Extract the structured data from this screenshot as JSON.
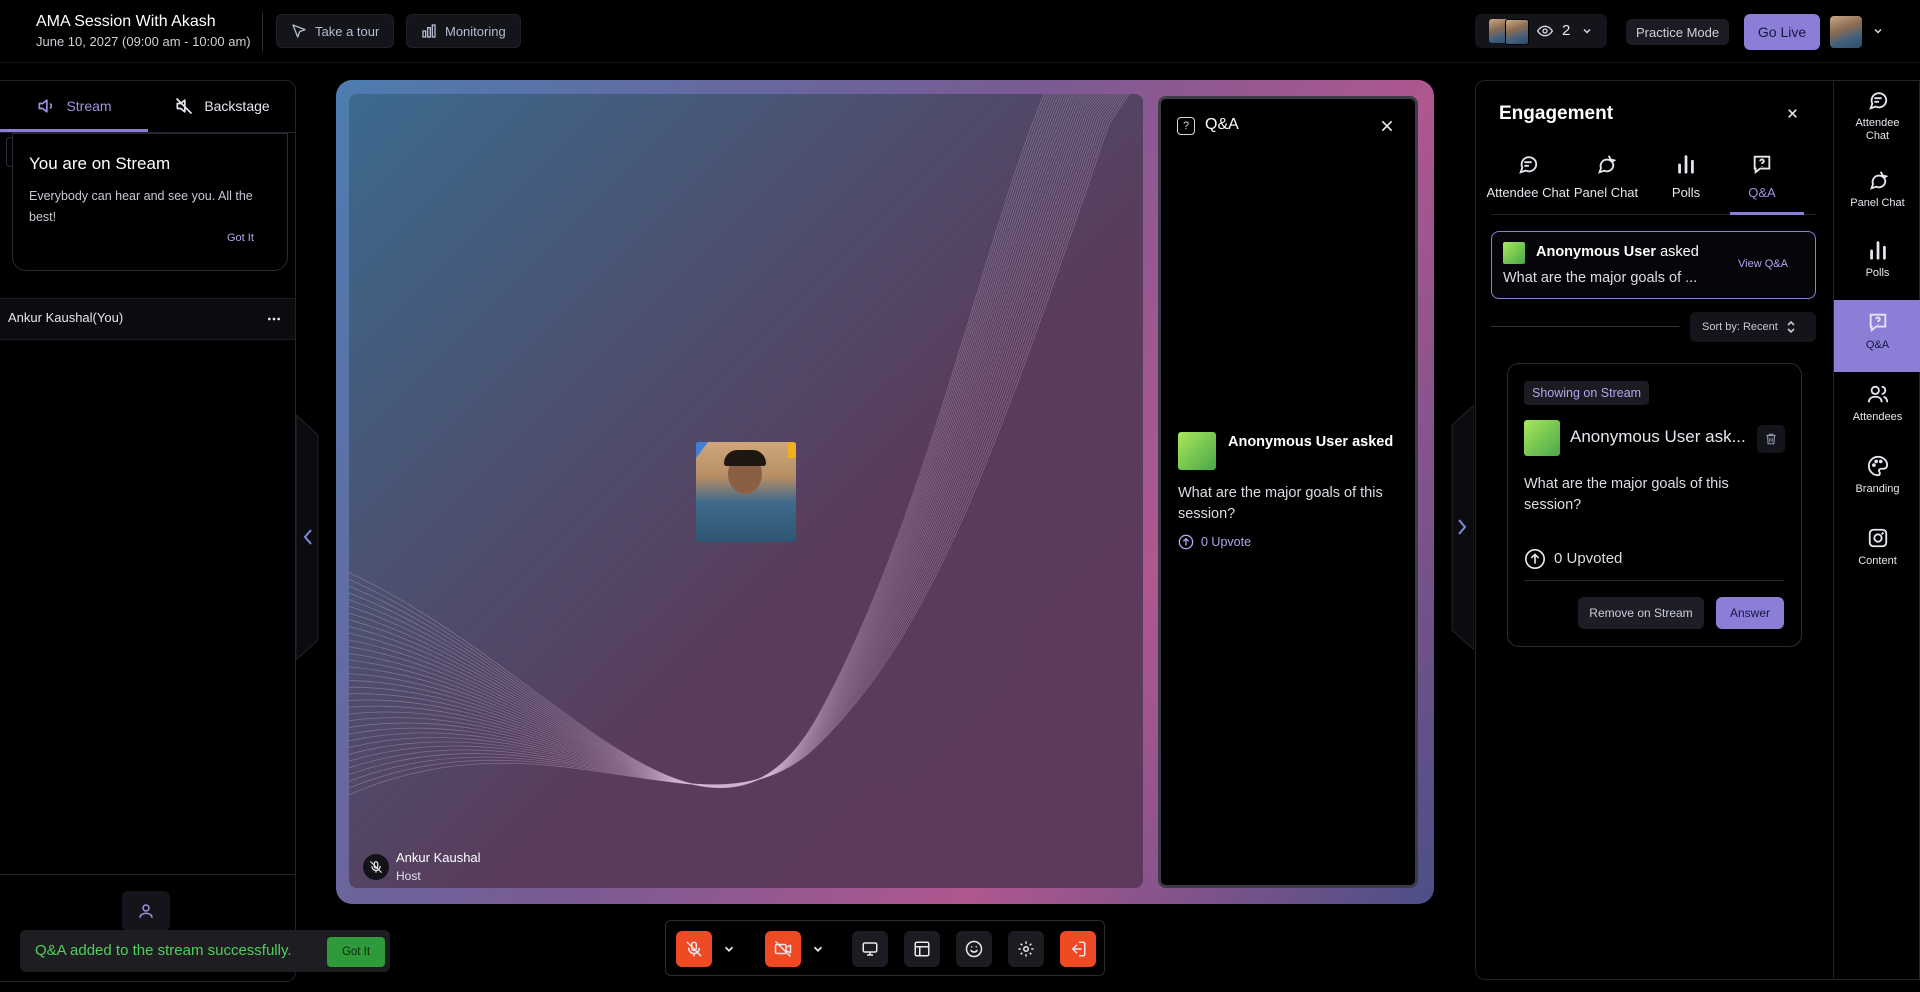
{
  "header": {
    "title": "AMA Session With Akash",
    "subtitle": "June 10, 2027 (09:00 am - 10:00 am)",
    "take_tour_label": "Take a tour",
    "monitoring_label": "Monitoring",
    "viewer_count": "2",
    "practice_mode_label": "Practice Mode",
    "go_live_label": "Go Live"
  },
  "left_panel": {
    "tabs": [
      {
        "label": "Stream",
        "active": true
      },
      {
        "label": "Backstage",
        "active": false
      }
    ],
    "notice": {
      "title": "You are on Stream",
      "body": "Everybody can hear and see you. All the best!",
      "button": "Got It"
    },
    "participant": {
      "name": "Ankur Kaushal(You)"
    }
  },
  "stage": {
    "speaker_name": "Ankur Kaushal",
    "speaker_role": "Host",
    "qa_overlay": {
      "title": "Q&A",
      "asker": "Anonymous User asked",
      "question": "What are the major goals of this session?",
      "upvote": "0 Upvote"
    }
  },
  "engagement": {
    "title": "Engagement",
    "tabs": [
      {
        "label": "Attendee Chat",
        "icon": "chat-icon"
      },
      {
        "label": "Panel Chat",
        "icon": "panel-chat-icon"
      },
      {
        "label": "Polls",
        "icon": "polls-icon"
      },
      {
        "label": "Q&A",
        "icon": "qa-icon",
        "active": true
      }
    ],
    "featured": {
      "user": "Anonymous User",
      "asked": "asked",
      "question": "What are the major goals of ...",
      "link": "View Q&A"
    },
    "sort_label": "Sort by: Recent",
    "question_card": {
      "badge": "Showing on Stream",
      "asker": "Anonymous User ask...",
      "question": "What are the major goals of this session?",
      "upvotes": "0 Upvoted",
      "remove_label": "Remove on Stream",
      "answer_label": "Answer"
    }
  },
  "right_rail": [
    {
      "label": "Attendee Chat",
      "icon": "chat-icon"
    },
    {
      "label": "Panel Chat",
      "icon": "panel-chat-icon"
    },
    {
      "label": "Polls",
      "icon": "polls-icon"
    },
    {
      "label": "Q&A",
      "icon": "qa-icon",
      "active": true
    },
    {
      "label": "Attendees",
      "icon": "attendees-icon"
    },
    {
      "label": "Branding",
      "icon": "palette-icon"
    },
    {
      "label": "Content",
      "icon": "content-icon"
    }
  ],
  "toast": {
    "message": "Q&A added to the stream successfully.",
    "button": "Got It"
  },
  "colors": {
    "accent": "#8a7ed6",
    "danger": "#ef4a23",
    "toast_text": "#4fd05a",
    "toast_button": "#2f9a3a"
  }
}
